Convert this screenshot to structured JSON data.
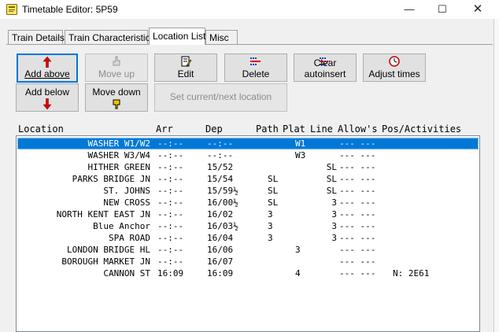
{
  "window": {
    "title": "Timetable Editor: 5P59"
  },
  "tabs": [
    {
      "label": "Train Details"
    },
    {
      "label": "Train Characteristics"
    },
    {
      "label": "Location List"
    },
    {
      "label": "Misc"
    }
  ],
  "buttons": {
    "add_above": "Add above",
    "add_below": "Add below",
    "move_up": "Move up",
    "move_down": "Move down",
    "edit": "Edit",
    "delete": "Delete",
    "clear_autoinsert": "Clear autoinsert",
    "adjust_times": "Adjust times",
    "set_current": "Set current/next location"
  },
  "columns": {
    "location": "Location",
    "arr": "Arr",
    "dep": "Dep",
    "path": "Path",
    "plat": "Plat",
    "line": "Line",
    "allows": "Allow's",
    "pos": "Pos/Activities"
  },
  "rows": [
    {
      "loc": "WASHER W1/W2",
      "arr": "--:--",
      "dep": "--:--",
      "path": "",
      "plat": "W1",
      "line": "",
      "allow": "--- ---",
      "pos": ""
    },
    {
      "loc": "WASHER W3/W4",
      "arr": "--:--",
      "dep": "--:--",
      "path": "",
      "plat": "W3",
      "line": "",
      "allow": "--- ---",
      "pos": ""
    },
    {
      "loc": "HITHER GREEN",
      "arr": "--:--",
      "dep": "15/52",
      "path": "",
      "plat": "",
      "line": "SL",
      "allow": "--- ---",
      "pos": ""
    },
    {
      "loc": "PARKS BRIDGE JN",
      "arr": "--:--",
      "dep": "15/54",
      "path": "SL",
      "plat": "",
      "line": "SL",
      "allow": "--- ---",
      "pos": ""
    },
    {
      "loc": "ST. JOHNS",
      "arr": "--:--",
      "dep": "15/59½",
      "path": "SL",
      "plat": "",
      "line": "SL",
      "allow": "--- ---",
      "pos": ""
    },
    {
      "loc": "NEW CROSS",
      "arr": "--:--",
      "dep": "16/00½",
      "path": "SL",
      "plat": "",
      "line": "3",
      "allow": "--- ---",
      "pos": ""
    },
    {
      "loc": "NORTH KENT EAST JN",
      "arr": "--:--",
      "dep": "16/02",
      "path": "3",
      "plat": "",
      "line": "3",
      "allow": "--- ---",
      "pos": ""
    },
    {
      "loc": "Blue Anchor",
      "arr": "--:--",
      "dep": "16/03½",
      "path": "3",
      "plat": "",
      "line": "3",
      "allow": "--- ---",
      "pos": ""
    },
    {
      "loc": "SPA ROAD",
      "arr": "--:--",
      "dep": "16/04",
      "path": "3",
      "plat": "",
      "line": "3",
      "allow": "--- ---",
      "pos": ""
    },
    {
      "loc": "LONDON BRIDGE HL",
      "arr": "--:--",
      "dep": "16/06",
      "path": "",
      "plat": "3",
      "line": "",
      "allow": "--- ---",
      "pos": ""
    },
    {
      "loc": "BOROUGH MARKET JN",
      "arr": "--:--",
      "dep": "16/07",
      "path": "",
      "plat": "",
      "line": "",
      "allow": "--- ---",
      "pos": ""
    },
    {
      "loc": "CANNON ST",
      "arr": "16:09",
      "dep": "16:09",
      "path": "",
      "plat": "4",
      "line": "",
      "allow": "--- ---",
      "pos": "N: 2E61"
    }
  ],
  "colors": {
    "selection": "#0078d7",
    "arrow_red": "#e00000",
    "face": "#f0f0f0"
  }
}
